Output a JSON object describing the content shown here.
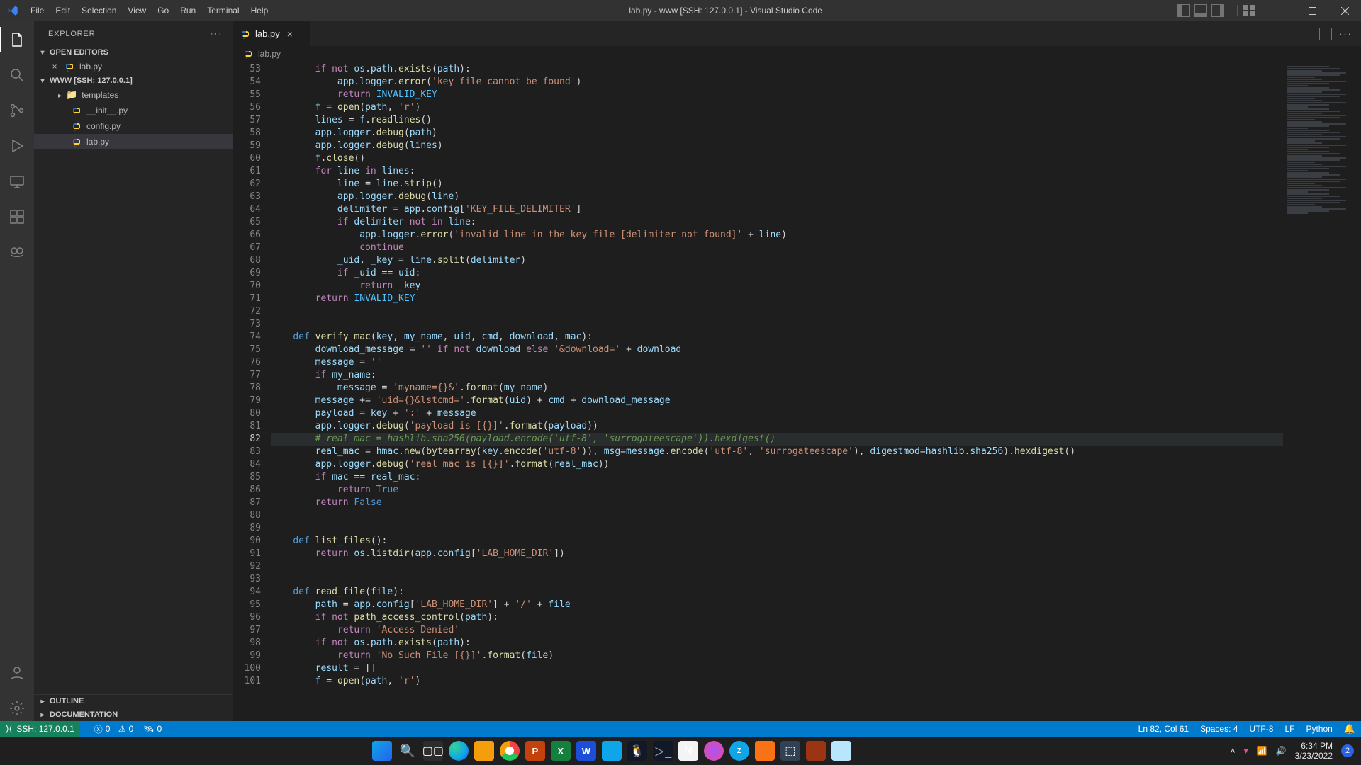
{
  "titlebar": {
    "menus": [
      "File",
      "Edit",
      "Selection",
      "View",
      "Go",
      "Run",
      "Terminal",
      "Help"
    ],
    "title": "lab.py - www [SSH: 127.0.0.1] - Visual Studio Code"
  },
  "explorer": {
    "title": "EXPLORER",
    "openEditors": "OPEN EDITORS",
    "openFile": "lab.py",
    "workspace": "WWW [SSH: 127.0.0.1]",
    "folder_templates": "templates",
    "file_init": "__init__.py",
    "file_config": "config.py",
    "file_lab": "lab.py",
    "outline": "OUTLINE",
    "documentation": "DOCUMENTATION"
  },
  "tabs": {
    "active": "lab.py"
  },
  "breadcrumb": {
    "file": "lab.py"
  },
  "statusbar": {
    "remote": "SSH: 127.0.0.1",
    "errors": "0",
    "warnings": "0",
    "ports": "0",
    "lncol": "Ln 82, Col 61",
    "spaces": "Spaces: 4",
    "encoding": "UTF-8",
    "eol": "LF",
    "language": "Python"
  },
  "taskbar": {
    "time": "6:34 PM",
    "date": "3/23/2022",
    "noti_count": "2"
  },
  "code_lines": [
    {
      "n": 53,
      "html": "        <span class='tk-kw'>if</span> <span class='tk-kw'>not</span> <span class='tk-id'>os</span>.<span class='tk-id'>path</span>.<span class='tk-fn'>exists</span>(<span class='tk-id'>path</span>):"
    },
    {
      "n": 54,
      "html": "            <span class='tk-id'>app</span>.<span class='tk-id'>logger</span>.<span class='tk-fn'>error</span>(<span class='tk-str'>'key file cannot be found'</span>)"
    },
    {
      "n": 55,
      "html": "            <span class='tk-kw'>return</span> <span class='tk-const'>INVALID_KEY</span>"
    },
    {
      "n": 56,
      "html": "        <span class='tk-id'>f</span> <span class='tk-op'>=</span> <span class='tk-fn'>open</span>(<span class='tk-id'>path</span>, <span class='tk-str'>'r'</span>)"
    },
    {
      "n": 57,
      "html": "        <span class='tk-id'>lines</span> <span class='tk-op'>=</span> <span class='tk-id'>f</span>.<span class='tk-fn'>readlines</span>()"
    },
    {
      "n": 58,
      "html": "        <span class='tk-id'>app</span>.<span class='tk-id'>logger</span>.<span class='tk-fn'>debug</span>(<span class='tk-id'>path</span>)"
    },
    {
      "n": 59,
      "html": "        <span class='tk-id'>app</span>.<span class='tk-id'>logger</span>.<span class='tk-fn'>debug</span>(<span class='tk-id'>lines</span>)"
    },
    {
      "n": 60,
      "html": "        <span class='tk-id'>f</span>.<span class='tk-fn'>close</span>()"
    },
    {
      "n": 61,
      "html": "        <span class='tk-kw'>for</span> <span class='tk-id'>line</span> <span class='tk-kw'>in</span> <span class='tk-id'>lines</span>:"
    },
    {
      "n": 62,
      "html": "            <span class='tk-id'>line</span> <span class='tk-op'>=</span> <span class='tk-id'>line</span>.<span class='tk-fn'>strip</span>()"
    },
    {
      "n": 63,
      "html": "            <span class='tk-id'>app</span>.<span class='tk-id'>logger</span>.<span class='tk-fn'>debug</span>(<span class='tk-id'>line</span>)"
    },
    {
      "n": 64,
      "html": "            <span class='tk-id'>delimiter</span> <span class='tk-op'>=</span> <span class='tk-id'>app</span>.<span class='tk-id'>config</span>[<span class='tk-str'>'KEY_FILE_DELIMITER'</span>]"
    },
    {
      "n": 65,
      "html": "            <span class='tk-kw'>if</span> <span class='tk-id'>delimiter</span> <span class='tk-kw'>not</span> <span class='tk-kw'>in</span> <span class='tk-id'>line</span>:"
    },
    {
      "n": 66,
      "html": "                <span class='tk-id'>app</span>.<span class='tk-id'>logger</span>.<span class='tk-fn'>error</span>(<span class='tk-str'>'invalid line in the key file [delimiter not found]'</span> <span class='tk-op'>+</span> <span class='tk-id'>line</span>)"
    },
    {
      "n": 67,
      "html": "                <span class='tk-kw'>continue</span>"
    },
    {
      "n": 68,
      "html": "            <span class='tk-id'>_uid</span>, <span class='tk-id'>_key</span> <span class='tk-op'>=</span> <span class='tk-id'>line</span>.<span class='tk-fn'>split</span>(<span class='tk-id'>delimiter</span>)"
    },
    {
      "n": 69,
      "html": "            <span class='tk-kw'>if</span> <span class='tk-id'>_uid</span> <span class='tk-op'>==</span> <span class='tk-id'>uid</span>:"
    },
    {
      "n": 70,
      "html": "                <span class='tk-kw'>return</span> <span class='tk-id'>_key</span>"
    },
    {
      "n": 71,
      "html": "        <span class='tk-kw'>return</span> <span class='tk-const'>INVALID_KEY</span>"
    },
    {
      "n": 72,
      "html": ""
    },
    {
      "n": 73,
      "html": ""
    },
    {
      "n": 74,
      "html": "    <span class='tk-def'>def</span> <span class='tk-name'>verify_mac</span>(<span class='tk-id'>key</span>, <span class='tk-id'>my_name</span>, <span class='tk-id'>uid</span>, <span class='tk-id'>cmd</span>, <span class='tk-id'>download</span>, <span class='tk-id'>mac</span>):"
    },
    {
      "n": 75,
      "html": "        <span class='tk-id'>download_message</span> <span class='tk-op'>=</span> <span class='tk-str'>''</span> <span class='tk-kw'>if</span> <span class='tk-kw'>not</span> <span class='tk-id'>download</span> <span class='tk-kw'>else</span> <span class='tk-str'>'&download='</span> <span class='tk-op'>+</span> <span class='tk-id'>download</span>"
    },
    {
      "n": 76,
      "html": "        <span class='tk-id'>message</span> <span class='tk-op'>=</span> <span class='tk-str'>''</span>"
    },
    {
      "n": 77,
      "html": "        <span class='tk-kw'>if</span> <span class='tk-id'>my_name</span>:"
    },
    {
      "n": 78,
      "html": "            <span class='tk-id'>message</span> <span class='tk-op'>=</span> <span class='tk-str'>'myname={}&'</span>.<span class='tk-fn'>format</span>(<span class='tk-id'>my_name</span>)"
    },
    {
      "n": 79,
      "html": "        <span class='tk-id'>message</span> <span class='tk-op'>+=</span> <span class='tk-str'>'uid={}&lstcmd='</span>.<span class='tk-fn'>format</span>(<span class='tk-id'>uid</span>) <span class='tk-op'>+</span> <span class='tk-id'>cmd</span> <span class='tk-op'>+</span> <span class='tk-id'>download_message</span>"
    },
    {
      "n": 80,
      "html": "        <span class='tk-id'>payload</span> <span class='tk-op'>=</span> <span class='tk-id'>key</span> <span class='tk-op'>+</span> <span class='tk-str'>':'</span> <span class='tk-op'>+</span> <span class='tk-id'>message</span>"
    },
    {
      "n": 81,
      "html": "        <span class='tk-id'>app</span>.<span class='tk-id'>logger</span>.<span class='tk-fn'>debug</span>(<span class='tk-str'>'payload is [{}]'</span>.<span class='tk-fn'>format</span>(<span class='tk-id'>payload</span>))"
    },
    {
      "n": 82,
      "html": "        <span class='tk-cmt'># real_mac = hashlib.sha256(payload.encode('utf-8', 'surrogateescape')).hexdigest()</span>",
      "current": true
    },
    {
      "n": 83,
      "html": "        <span class='tk-id'>real_mac</span> <span class='tk-op'>=</span> <span class='tk-id'>hmac</span>.<span class='tk-fn'>new</span>(<span class='tk-fn'>bytearray</span>(<span class='tk-id'>key</span>.<span class='tk-fn'>encode</span>(<span class='tk-str'>'utf-8'</span>)), <span class='tk-id'>msg</span><span class='tk-op'>=</span><span class='tk-id'>message</span>.<span class='tk-fn'>encode</span>(<span class='tk-str'>'utf-8'</span>, <span class='tk-str'>'surrogateescape'</span>), <span class='tk-id'>digestmod</span><span class='tk-op'>=</span><span class='tk-id'>hashlib</span>.<span class='tk-id'>sha256</span>).<span class='tk-fn'>hexdigest</span>()"
    },
    {
      "n": 84,
      "html": "        <span class='tk-id'>app</span>.<span class='tk-id'>logger</span>.<span class='tk-fn'>debug</span>(<span class='tk-str'>'real mac is [{}]'</span>.<span class='tk-fn'>format</span>(<span class='tk-id'>real_mac</span>))"
    },
    {
      "n": 85,
      "html": "        <span class='tk-kw'>if</span> <span class='tk-id'>mac</span> <span class='tk-op'>==</span> <span class='tk-id'>real_mac</span>:"
    },
    {
      "n": 86,
      "html": "            <span class='tk-kw'>return</span> <span class='tk-bool'>True</span>"
    },
    {
      "n": 87,
      "html": "        <span class='tk-kw'>return</span> <span class='tk-bool'>False</span>"
    },
    {
      "n": 88,
      "html": ""
    },
    {
      "n": 89,
      "html": ""
    },
    {
      "n": 90,
      "html": "    <span class='tk-def'>def</span> <span class='tk-name'>list_files</span>():"
    },
    {
      "n": 91,
      "html": "        <span class='tk-kw'>return</span> <span class='tk-id'>os</span>.<span class='tk-fn'>listdir</span>(<span class='tk-id'>app</span>.<span class='tk-id'>config</span>[<span class='tk-str'>'LAB_HOME_DIR'</span>])"
    },
    {
      "n": 92,
      "html": ""
    },
    {
      "n": 93,
      "html": ""
    },
    {
      "n": 94,
      "html": "    <span class='tk-def'>def</span> <span class='tk-name'>read_file</span>(<span class='tk-id'>file</span>):"
    },
    {
      "n": 95,
      "html": "        <span class='tk-id'>path</span> <span class='tk-op'>=</span> <span class='tk-id'>app</span>.<span class='tk-id'>config</span>[<span class='tk-str'>'LAB_HOME_DIR'</span>] <span class='tk-op'>+</span> <span class='tk-str'>'/'</span> <span class='tk-op'>+</span> <span class='tk-id'>file</span>"
    },
    {
      "n": 96,
      "html": "        <span class='tk-kw'>if</span> <span class='tk-kw'>not</span> <span class='tk-fn'>path_access_control</span>(<span class='tk-id'>path</span>):"
    },
    {
      "n": 97,
      "html": "            <span class='tk-kw'>return</span> <span class='tk-str'>'Access Denied'</span>"
    },
    {
      "n": 98,
      "html": "        <span class='tk-kw'>if</span> <span class='tk-kw'>not</span> <span class='tk-id'>os</span>.<span class='tk-id'>path</span>.<span class='tk-fn'>exists</span>(<span class='tk-id'>path</span>):"
    },
    {
      "n": 99,
      "html": "            <span class='tk-kw'>return</span> <span class='tk-str'>'No Such File [{}]'</span>.<span class='tk-fn'>format</span>(<span class='tk-id'>file</span>)"
    },
    {
      "n": 100,
      "html": "        <span class='tk-id'>result</span> <span class='tk-op'>=</span> []"
    },
    {
      "n": 101,
      "html": "        <span class='tk-id'>f</span> <span class='tk-op'>=</span> <span class='tk-fn'>open</span>(<span class='tk-id'>path</span>, <span class='tk-str'>'r'</span>)"
    }
  ]
}
